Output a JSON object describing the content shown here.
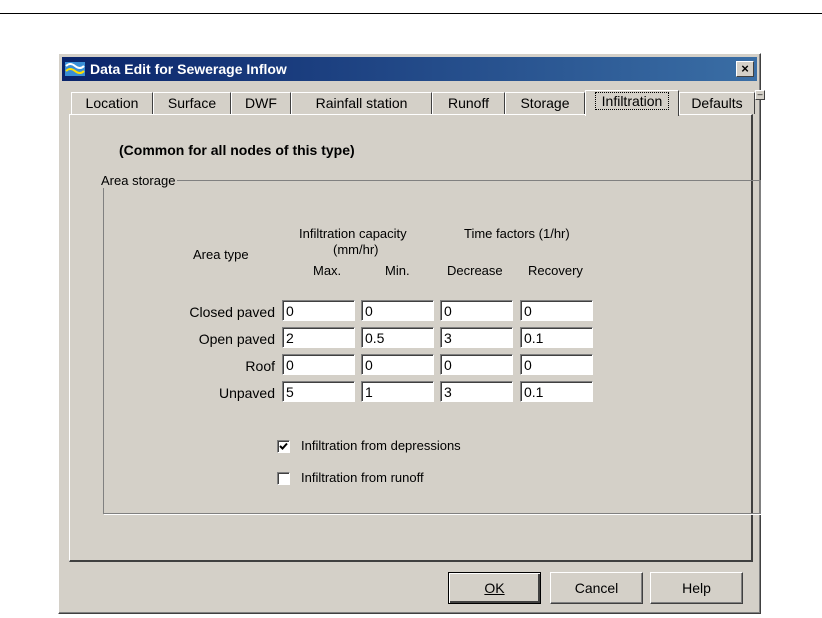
{
  "window": {
    "title": "Data Edit for Sewerage Inflow",
    "close_glyph": "×",
    "icon": "network-icon"
  },
  "tabs": [
    {
      "label": "Location"
    },
    {
      "label": "Surface"
    },
    {
      "label": "DWF"
    },
    {
      "label": "Rainfall station"
    },
    {
      "label": "Runoff"
    },
    {
      "label": "Storage"
    },
    {
      "label": "Infiltration",
      "active": true
    },
    {
      "label": "Defaults"
    }
  ],
  "panel": {
    "common_label": "(Common for all nodes of this type)",
    "group_label": "Area storage",
    "headers": {
      "area_type": "Area type",
      "infiltration_capacity": "Infiltration capacity",
      "infiltration_unit": "(mm/hr)",
      "time_factors": "Time factors (1/hr)",
      "max": "Max.",
      "min": "Min.",
      "decrease": "Decrease",
      "recovery": "Recovery"
    },
    "rows": [
      {
        "label": "Closed paved",
        "max": "0",
        "min": "0",
        "decrease": "0",
        "recovery": "0"
      },
      {
        "label": "Open paved",
        "max": "2",
        "min": "0.5",
        "decrease": "3",
        "recovery": "0.1"
      },
      {
        "label": "Roof",
        "max": "0",
        "min": "0",
        "decrease": "0",
        "recovery": "0"
      },
      {
        "label": "Unpaved",
        "max": "5",
        "min": "1",
        "decrease": "3",
        "recovery": "0.1"
      }
    ],
    "checkboxes": [
      {
        "label": "Infiltration from depressions",
        "checked": true
      },
      {
        "label": "Infiltration from runoff",
        "checked": false
      }
    ]
  },
  "buttons": {
    "ok": "OK",
    "cancel": "Cancel",
    "help": "Help"
  },
  "colors": {
    "face": "#d4d0c8",
    "title_start": "#0a246a",
    "title_end": "#3a6ea5"
  }
}
